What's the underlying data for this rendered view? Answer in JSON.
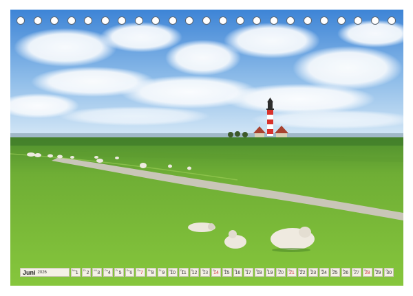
{
  "calendar": {
    "month": "Juni",
    "year": "2026",
    "days": [
      {
        "n": "1",
        "wd": "Mo",
        "type": "weekday"
      },
      {
        "n": "2",
        "wd": "Di",
        "type": "weekday"
      },
      {
        "n": "3",
        "wd": "Mi",
        "type": "weekday"
      },
      {
        "n": "4",
        "wd": "Do",
        "type": "weekday"
      },
      {
        "n": "5",
        "wd": "Fr",
        "type": "weekday"
      },
      {
        "n": "6",
        "wd": "Sa",
        "type": "sat"
      },
      {
        "n": "7",
        "wd": "So",
        "type": "sun"
      },
      {
        "n": "8",
        "wd": "Mo",
        "type": "weekday"
      },
      {
        "n": "9",
        "wd": "Di",
        "type": "weekday"
      },
      {
        "n": "10",
        "wd": "Mi",
        "type": "weekday"
      },
      {
        "n": "11",
        "wd": "Do",
        "type": "weekday"
      },
      {
        "n": "12",
        "wd": "Fr",
        "type": "weekday"
      },
      {
        "n": "13",
        "wd": "Sa",
        "type": "sat"
      },
      {
        "n": "14",
        "wd": "So",
        "type": "sun"
      },
      {
        "n": "15",
        "wd": "Mo",
        "type": "weekday"
      },
      {
        "n": "16",
        "wd": "Di",
        "type": "weekday"
      },
      {
        "n": "17",
        "wd": "Mi",
        "type": "weekday"
      },
      {
        "n": "18",
        "wd": "Do",
        "type": "weekday"
      },
      {
        "n": "19",
        "wd": "Fr",
        "type": "weekday"
      },
      {
        "n": "20",
        "wd": "Sa",
        "type": "sat"
      },
      {
        "n": "21",
        "wd": "So",
        "type": "sun"
      },
      {
        "n": "22",
        "wd": "Mo",
        "type": "weekday"
      },
      {
        "n": "23",
        "wd": "Di",
        "type": "weekday"
      },
      {
        "n": "24",
        "wd": "Mi",
        "type": "weekday"
      },
      {
        "n": "25",
        "wd": "Do",
        "type": "weekday"
      },
      {
        "n": "26",
        "wd": "Fr",
        "type": "weekday"
      },
      {
        "n": "27",
        "wd": "Sa",
        "type": "sat"
      },
      {
        "n": "28",
        "wd": "So",
        "type": "sun"
      },
      {
        "n": "29",
        "wd": "Mo",
        "type": "weekday"
      },
      {
        "n": "30",
        "wd": "Di",
        "type": "weekday"
      }
    ]
  },
  "colors": {
    "sky_top": "#3f86d8",
    "sky_bottom": "#c9e1f5",
    "grass_near": "#7cc23a",
    "grass_far": "#5a9a34",
    "path": "#c9c6b8",
    "lighthouse_red": "#d8322c",
    "sunday_red": "#d0343a"
  }
}
